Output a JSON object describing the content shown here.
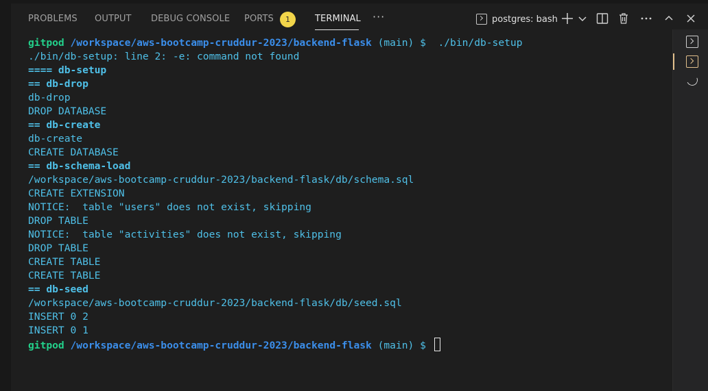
{
  "tabs": [
    {
      "label": "PROBLEMS",
      "active": false
    },
    {
      "label": "OUTPUT",
      "active": false
    },
    {
      "label": "DEBUG CONSOLE",
      "active": false
    },
    {
      "label": "PORTS",
      "active": false,
      "badge": "1"
    },
    {
      "label": "TERMINAL",
      "active": true
    }
  ],
  "toolbar": {
    "more_label": "···",
    "terminal_name": "postgres: bash"
  },
  "terminal": {
    "lines": [
      {
        "parts": [
          {
            "text": "gitpod",
            "style": "green"
          },
          {
            "text": " "
          },
          {
            "text": "/workspace/aws-bootcamp-cruddur-2023/backend-flask",
            "style": "blue"
          },
          {
            "text": " (main) $  ./bin/db-setup"
          }
        ]
      },
      {
        "parts": [
          {
            "text": "./bin/db-setup: line 2: -e: command not found"
          }
        ]
      },
      {
        "parts": [
          {
            "text": "==== db-setup",
            "style": "bright"
          }
        ]
      },
      {
        "parts": [
          {
            "text": "== db-drop",
            "style": "bright"
          }
        ]
      },
      {
        "parts": [
          {
            "text": "db-drop"
          }
        ]
      },
      {
        "parts": [
          {
            "text": "DROP DATABASE"
          }
        ]
      },
      {
        "parts": [
          {
            "text": "== db-create",
            "style": "bright"
          }
        ]
      },
      {
        "parts": [
          {
            "text": "db-create"
          }
        ]
      },
      {
        "parts": [
          {
            "text": "CREATE DATABASE"
          }
        ]
      },
      {
        "parts": [
          {
            "text": "== db-schema-load",
            "style": "bright"
          }
        ]
      },
      {
        "parts": [
          {
            "text": "/workspace/aws-bootcamp-cruddur-2023/backend-flask/db/schema.sql"
          }
        ]
      },
      {
        "parts": [
          {
            "text": "CREATE EXTENSION"
          }
        ]
      },
      {
        "parts": [
          {
            "text": "NOTICE:  table \"users\" does not exist, skipping"
          }
        ]
      },
      {
        "parts": [
          {
            "text": "DROP TABLE"
          }
        ]
      },
      {
        "parts": [
          {
            "text": "NOTICE:  table \"activities\" does not exist, skipping"
          }
        ]
      },
      {
        "parts": [
          {
            "text": "DROP TABLE"
          }
        ]
      },
      {
        "parts": [
          {
            "text": "CREATE TABLE"
          }
        ]
      },
      {
        "parts": [
          {
            "text": "CREATE TABLE"
          }
        ]
      },
      {
        "parts": [
          {
            "text": "== db-seed",
            "style": "bright"
          }
        ]
      },
      {
        "parts": [
          {
            "text": "/workspace/aws-bootcamp-cruddur-2023/backend-flask/db/seed.sql"
          }
        ]
      },
      {
        "parts": [
          {
            "text": "INSERT 0 2"
          }
        ]
      },
      {
        "parts": [
          {
            "text": "INSERT 0 1"
          }
        ]
      },
      {
        "parts": [
          {
            "text": "gitpod",
            "style": "green"
          },
          {
            "text": " "
          },
          {
            "text": "/workspace/aws-bootcamp-cruddur-2023/backend-flask",
            "style": "blue"
          },
          {
            "text": " (main) $ "
          }
        ],
        "cursor": true
      }
    ]
  },
  "colors": {
    "background": "#1e1e1e",
    "prompt_user": "#23d18b",
    "prompt_path": "#3b8eea",
    "output_text": "#4fc0e8",
    "badge": "#f2d54a",
    "active_rail_accent": "#e2c08d"
  },
  "icons": {
    "add": "plus-icon",
    "dropdown": "chevron-down-icon",
    "split": "split-terminal-icon",
    "kill": "trash-icon",
    "more": "ellipsis-icon",
    "maximize": "chevron-up-icon",
    "close": "close-icon",
    "terminal": "terminal-icon",
    "loading": "spinner-icon"
  }
}
